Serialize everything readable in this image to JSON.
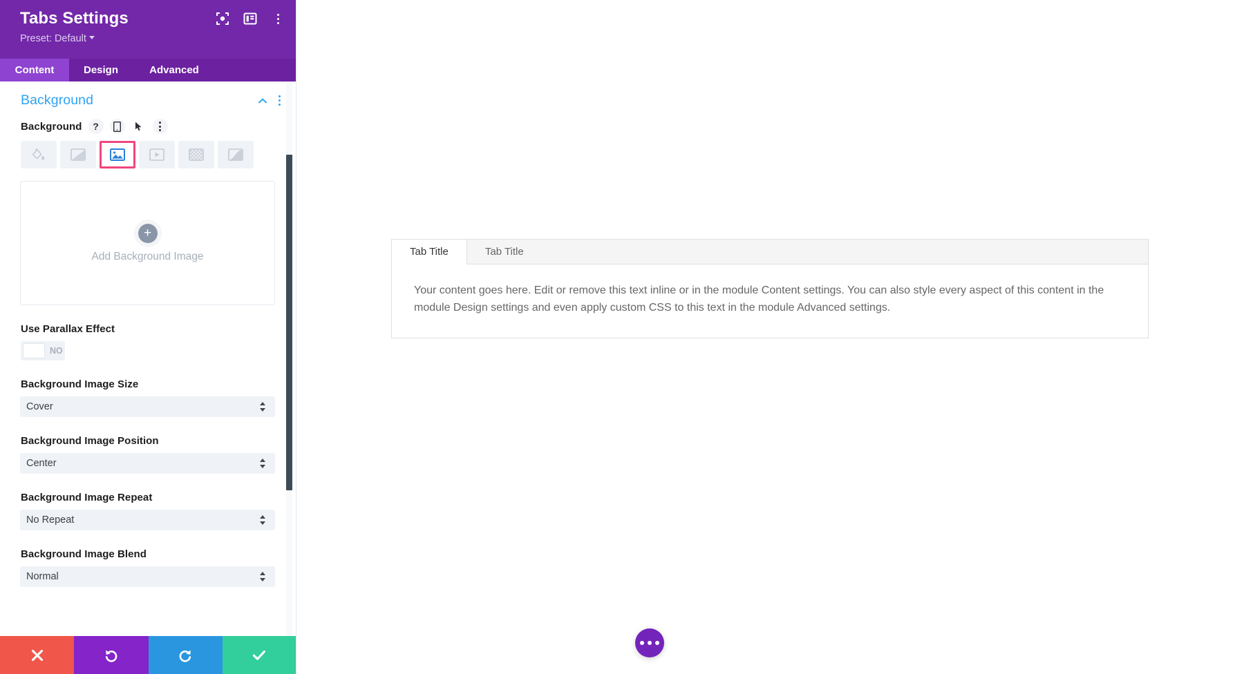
{
  "panel": {
    "title": "Tabs Settings",
    "preset_label": "Preset: Default",
    "header_icons": [
      {
        "name": "focus-target-icon"
      },
      {
        "name": "layout-panel-icon"
      },
      {
        "name": "more-vertical-icon"
      }
    ],
    "tabs": [
      {
        "label": "Content",
        "active": true
      },
      {
        "label": "Design",
        "active": false
      },
      {
        "label": "Advanced",
        "active": false
      }
    ],
    "section": {
      "title": "Background",
      "collapse_icon": "chevron-up-icon",
      "options_icon": "more-vertical-icon"
    },
    "background_field": {
      "label": "Background",
      "help_icon": "question-mark-icon",
      "responsive_icon": "mobile-device-icon",
      "hover_icon": "cursor-pointer-icon",
      "more_icon": "more-vertical-icon",
      "types": [
        {
          "name": "background-color",
          "selected": false
        },
        {
          "name": "background-gradient",
          "selected": false
        },
        {
          "name": "background-image",
          "selected": true
        },
        {
          "name": "background-video",
          "selected": false
        },
        {
          "name": "background-pattern",
          "selected": false
        },
        {
          "name": "background-mask",
          "selected": false
        }
      ],
      "selected_outline_color": "#f0457f"
    },
    "upload": {
      "caption": "Add Background Image",
      "plus_icon": "plus-circle-icon"
    },
    "fields": [
      {
        "type": "toggle",
        "label": "Use Parallax Effect",
        "value": "NO",
        "name": "use-parallax-effect"
      },
      {
        "type": "select",
        "label": "Background Image Size",
        "value": "Cover",
        "name": "background-image-size"
      },
      {
        "type": "select",
        "label": "Background Image Position",
        "value": "Center",
        "name": "background-image-position"
      },
      {
        "type": "select",
        "label": "Background Image Repeat",
        "value": "No Repeat",
        "name": "background-image-repeat"
      },
      {
        "type": "select",
        "label": "Background Image Blend",
        "value": "Normal",
        "name": "background-image-blend"
      }
    ],
    "footer": [
      {
        "name": "cancel-button",
        "icon": "close-x-icon",
        "color": "#f0564a"
      },
      {
        "name": "undo-button",
        "icon": "undo-arrow-icon",
        "color": "#8424c9"
      },
      {
        "name": "redo-button",
        "icon": "redo-arrow-icon",
        "color": "#2a96e0"
      },
      {
        "name": "save-button",
        "icon": "checkmark-icon",
        "color": "#32ce9b"
      }
    ],
    "accent_colors": {
      "header_purple": "#7228a8",
      "tabbar_purple": "#6c21a0",
      "active_tab_purple": "#8e44d0",
      "section_blue": "#2ea3f2"
    }
  },
  "canvas": {
    "module": {
      "tabs": [
        {
          "label": "Tab Title",
          "active": true
        },
        {
          "label": "Tab Title",
          "active": false
        }
      ],
      "content": "Your content goes here. Edit or remove this text inline or in the module Content settings. You can also style every aspect of this content in the module Design settings and even apply custom CSS to this text in the module Advanced settings."
    },
    "fab": {
      "name": "page-settings-fab",
      "icon": "ellipsis-icon",
      "color": "#7324ba"
    }
  }
}
